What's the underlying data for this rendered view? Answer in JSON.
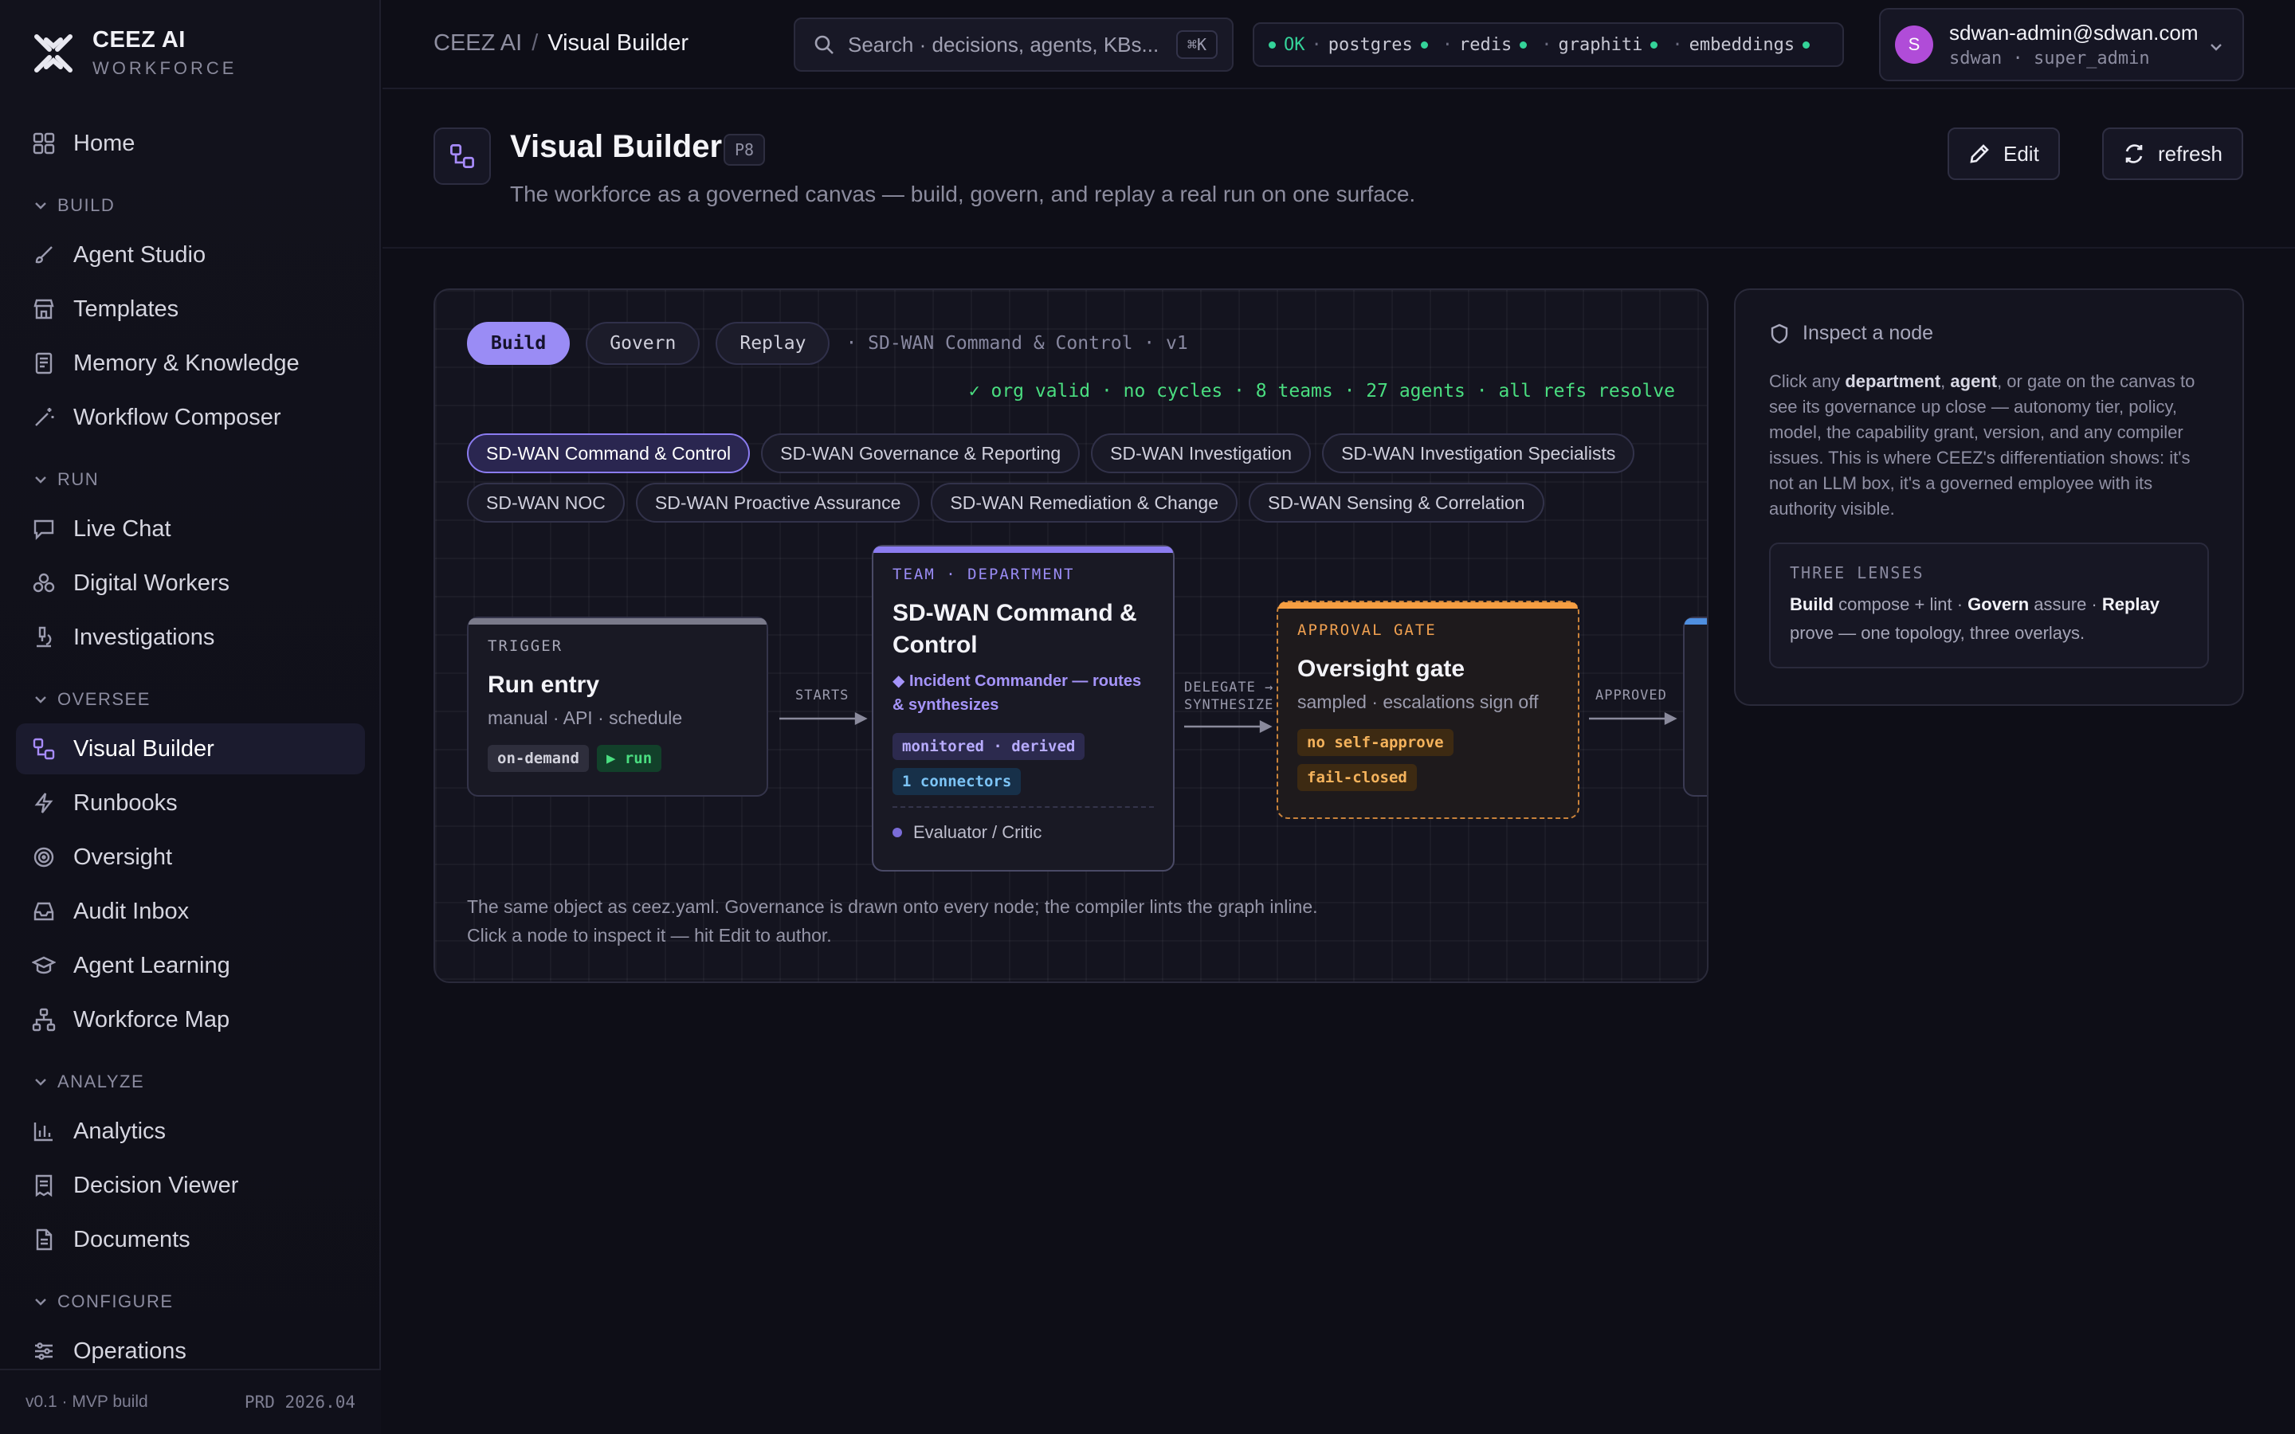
{
  "brand": {
    "name": "CEEZ AI",
    "sub": "WORKFORCE"
  },
  "nav": {
    "home": "Home",
    "sections": {
      "build": "BUILD",
      "run": "RUN",
      "oversee": "OVERSEE",
      "analyze": "ANALYZE",
      "configure": "CONFIGURE"
    },
    "build": [
      "Agent Studio",
      "Templates",
      "Memory & Knowledge",
      "Workflow Composer"
    ],
    "run": [
      "Live Chat",
      "Digital Workers",
      "Investigations"
    ],
    "oversee": [
      "Visual Builder",
      "Runbooks",
      "Oversight",
      "Audit Inbox",
      "Agent Learning",
      "Workforce Map"
    ],
    "analyze": [
      "Analytics",
      "Decision Viewer",
      "Documents"
    ],
    "configure": [
      "Operations"
    ]
  },
  "footer": {
    "version": "v0.1 · MVP build",
    "build": "PRD 2026.04"
  },
  "header": {
    "crumb_root": "CEEZ AI",
    "crumb_sep": "/",
    "crumb_current": "Visual Builder",
    "search_placeholder": "Search · decisions, agents, KBs...",
    "search_kbd": "⌘K",
    "status": {
      "ok": "OK",
      "services": [
        "postgres",
        "redis",
        "graphiti",
        "embeddings"
      ]
    },
    "user": {
      "initial": "S",
      "email": "sdwan-admin@sdwan.com",
      "role": "sdwan · super_admin"
    }
  },
  "page": {
    "title": "Visual Builder",
    "badge": "P8",
    "subtitle": "The workforce as a governed canvas — build, govern, and replay a real run on one surface.",
    "edit_label": "Edit",
    "refresh_label": "refresh"
  },
  "canvas": {
    "tabs": [
      "Build",
      "Govern",
      "Replay"
    ],
    "org_label": "· SD-WAN Command & Control · v1",
    "lint": "✓ org valid · no cycles · 8 teams · 27 agents · all refs resolve",
    "chips": [
      "SD-WAN Command & Control",
      "SD-WAN Governance & Reporting",
      "SD-WAN Investigation",
      "SD-WAN Investigation Specialists",
      "SD-WAN NOC",
      "SD-WAN Proactive Assurance",
      "SD-WAN Remediation & Change",
      "SD-WAN Sensing & Correlation"
    ],
    "nodes": {
      "trigger": {
        "kicker": "TRIGGER",
        "title": "Run entry",
        "sub": "manual · API · schedule",
        "tags": [
          "on-demand",
          "▶ run"
        ]
      },
      "team": {
        "kicker": "TEAM · DEPARTMENT",
        "title": "SD-WAN Command & Control",
        "lead": "◆ Incident Commander — routes & synthesizes",
        "tags": [
          "monitored · derived",
          "1 connectors"
        ],
        "member": "Evaluator / Critic"
      },
      "gate": {
        "kicker": "APPROVAL GATE",
        "title": "Oversight gate",
        "sub": "sampled · escalations sign off",
        "tags": [
          "no self-approve",
          "fail-closed"
        ]
      }
    },
    "edges": {
      "starts": "STARTS",
      "delegate": "DELEGATE →",
      "synthesize": "SYNTHESIZE",
      "approved": "APPROVED"
    },
    "footnote_1": "The same object as ceez.yaml. Governance is drawn onto every node; the compiler lints the graph inline.",
    "footnote_2": "Click a node to inspect it — hit Edit to author."
  },
  "inspector": {
    "title": "Inspect a node",
    "body": {
      "p1": "Click any ",
      "b1": "department",
      "p2": ", ",
      "b2": "agent",
      "p3": ", or gate on the canvas to see its governance up close — autonomy tier, policy, model, the capability grant, version, and any compiler issues. This is where CEEZ's differentiation shows: it's not an LLM box, it's a governed employee with its authority visible."
    },
    "lenses_title": "THREE LENSES",
    "lenses": {
      "build": "Build",
      "build_text": " compose + lint · ",
      "govern": "Govern",
      "govern_text": " assure · ",
      "replay": "Replay",
      "replay_text": " prove — one topology, three overlays."
    }
  },
  "colors": {
    "accent": "#9a8cf5",
    "ok": "#34d399",
    "gate": "#f59e42"
  }
}
